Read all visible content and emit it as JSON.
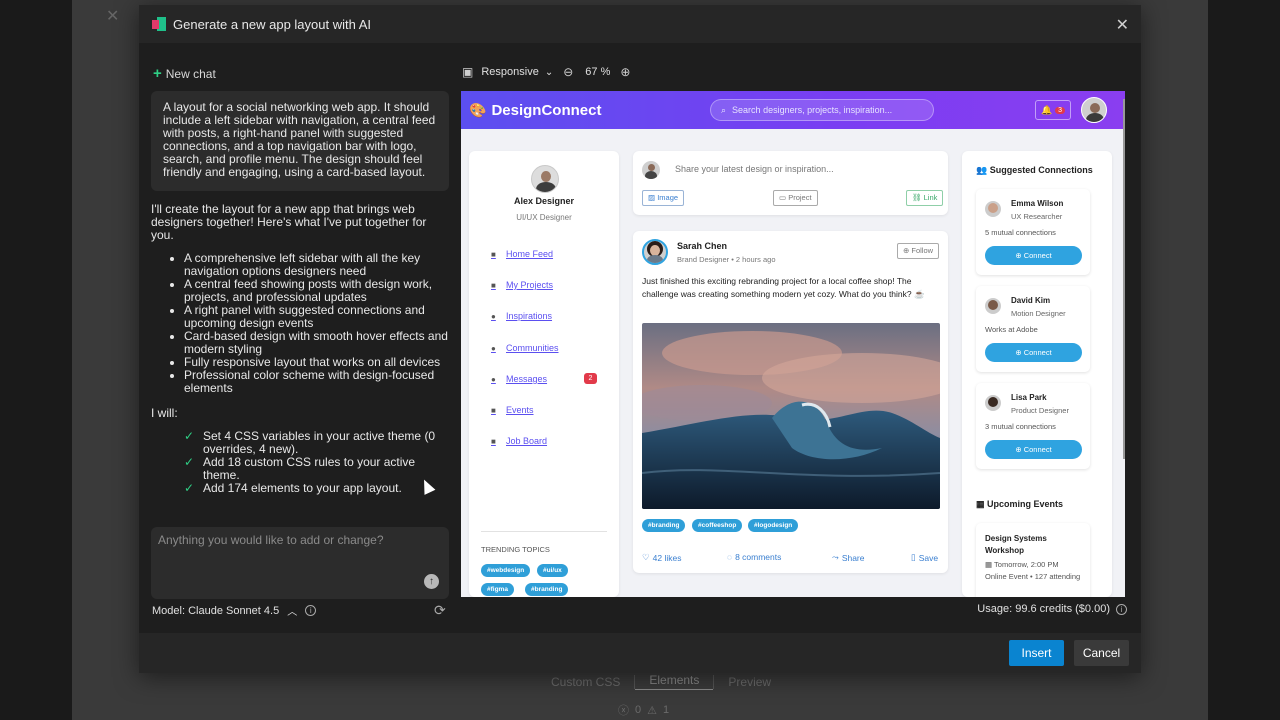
{
  "background": {
    "close_glyph": "✕",
    "tabs": [
      "Custom CSS",
      "Elements",
      "Preview"
    ],
    "status_errors": "0",
    "status_warnings": "1"
  },
  "modal": {
    "title": "Generate a new app layout with AI",
    "close_glyph": "✕"
  },
  "chat": {
    "new_chat_label": "New chat",
    "user_message": "A layout for a social networking web app. It should include a left sidebar with navigation, a central feed with posts, a right-hand panel with suggested connections, and a top navigation bar with logo, search, and profile menu. The design should feel friendly and engaging, using a card-based layout.",
    "ai_intro": "I'll create the layout for a new app that brings web designers together! Here's what I've put together for you.",
    "ai_bullets": [
      "A comprehensive left sidebar with all the key navigation options designers need",
      "A central feed showing posts with design work, projects, and professional updates",
      "A right panel with suggested connections and upcoming design events",
      "Card-based design with smooth hover effects and modern styling",
      "Fully responsive layout that works on all devices",
      "Professional color scheme with design-focused elements"
    ],
    "will_label": "I will:",
    "will_items": [
      "Set 4 CSS variables in your active theme (0 overrides, 4 new).",
      "Add 18 custom CSS rules to your active theme.",
      "Add 174 elements to your app layout."
    ],
    "prompt_placeholder": "Anything you would like to add or change?",
    "model_label": "Model: Claude Sonnet 4.5"
  },
  "toolbar": {
    "viewport": "Responsive",
    "zoom": "67 %"
  },
  "preview": {
    "brand": "DesignConnect",
    "search_placeholder": "Search designers, projects, inspiration...",
    "notif_count": "3",
    "profile": {
      "name": "Alex Designer",
      "role": "UI/UX Designer"
    },
    "nav_items": [
      "Home Feed",
      "My Projects",
      "Inspirations",
      "Communities",
      "Messages",
      "Events",
      "Job Board"
    ],
    "messages_badge": "2",
    "trending_title": "TRENDING TOPICS",
    "trending_tags": [
      "#webdesign",
      "#ui/ux",
      "#figma",
      "#branding"
    ],
    "compose": {
      "placeholder": "Share your latest design or inspiration...",
      "image": "Image",
      "project": "Project",
      "link": "Link"
    },
    "post": {
      "author": "Sarah Chen",
      "meta": "Brand Designer • 2 hours ago",
      "follow": "Follow",
      "text": "Just finished this exciting rebranding project for a local coffee shop! The challenge was creating something modern yet cozy. What do you think? ☕",
      "tags": [
        "#branding",
        "#coffeeshop",
        "#logodesign"
      ],
      "likes": "42 likes",
      "comments": "8 comments",
      "share": "Share",
      "save": "Save"
    },
    "suggested_title": "Suggested Connections",
    "connections": [
      {
        "name": "Emma Wilson",
        "role": "UX Researcher",
        "detail": "5 mutual connections",
        "button": "Connect"
      },
      {
        "name": "David Kim",
        "role": "Motion Designer",
        "detail": "Works at Adobe",
        "button": "Connect"
      },
      {
        "name": "Lisa Park",
        "role": "Product Designer",
        "detail": "3 mutual connections",
        "button": "Connect"
      }
    ],
    "events_title": "Upcoming Events",
    "event": {
      "title": "Design Systems Workshop",
      "time": "Tomorrow, 2:00 PM",
      "detail": "Online Event • 127 attending"
    }
  },
  "footer": {
    "usage_label": "Usage: ",
    "usage_value": "99.6 credits ($0.00)",
    "insert": "Insert",
    "cancel": "Cancel"
  },
  "colors": {
    "accent": "#0a84d0",
    "brand_gradient_start": "#5b4ff0",
    "brand_gradient_end": "#8a3ef0",
    "success_check": "#2fcf85",
    "tag": "#2f9fd8"
  }
}
